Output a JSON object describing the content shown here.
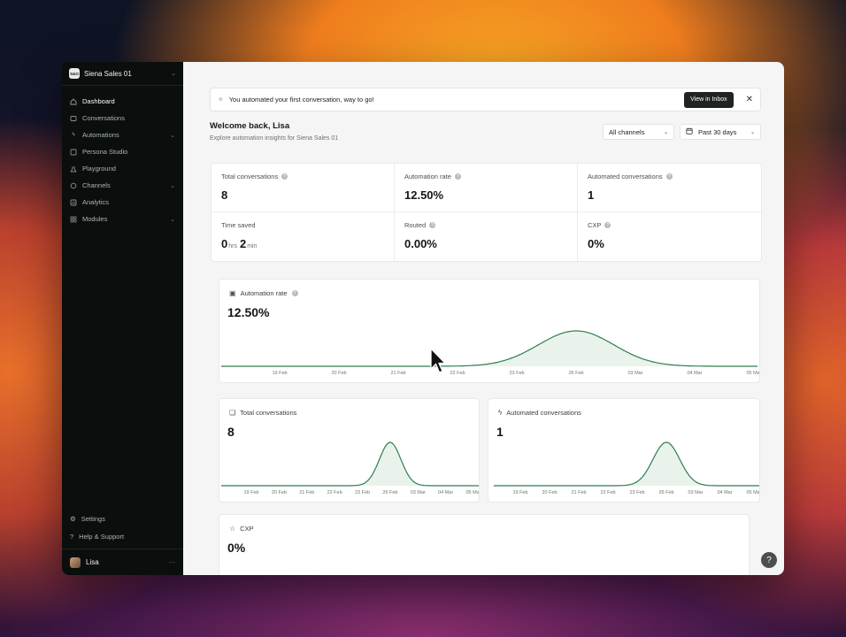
{
  "workspace": {
    "logo_text": "S&O",
    "name": "Siena Sales 01"
  },
  "sidebar": {
    "items": [
      {
        "label": "Dashboard",
        "icon": "home-icon",
        "active": true,
        "has_children": false
      },
      {
        "label": "Conversations",
        "icon": "inbox-icon",
        "active": false,
        "has_children": false
      },
      {
        "label": "Automations",
        "icon": "bolt-icon",
        "active": false,
        "has_children": true
      },
      {
        "label": "Persona Studio",
        "icon": "persona-icon",
        "active": false,
        "has_children": false
      },
      {
        "label": "Playground",
        "icon": "flask-icon",
        "active": false,
        "has_children": false
      },
      {
        "label": "Channels",
        "icon": "chat-icon",
        "active": false,
        "has_children": true
      },
      {
        "label": "Analytics",
        "icon": "chart-icon",
        "active": false,
        "has_children": false
      },
      {
        "label": "Modules",
        "icon": "grid-icon",
        "active": false,
        "has_children": true
      }
    ],
    "settings_label": "Settings",
    "help_label": "Help & Support",
    "user_name": "Lisa"
  },
  "banner": {
    "text": "You automated your first conversation, way to go!",
    "button_label": "View in Inbox"
  },
  "header": {
    "welcome": "Welcome back, Lisa",
    "subtitle": "Explore automation insights for Siena Sales 01",
    "channel_filter": "All channels",
    "date_filter": "Past 30 days"
  },
  "kpis": {
    "total_conversations": {
      "label": "Total conversations",
      "value": "8"
    },
    "automation_rate": {
      "label": "Automation rate",
      "value": "12.50%"
    },
    "automated_conversations": {
      "label": "Automated conversations",
      "value": "1"
    },
    "time_saved": {
      "label": "Time saved",
      "hours": "0",
      "hours_unit": "hrs",
      "minutes": "2",
      "minutes_unit": "min"
    },
    "routed": {
      "label": "Routed",
      "value": "0.00%"
    },
    "cxp": {
      "label": "CXP",
      "value": "0%"
    }
  },
  "colors": {
    "accent": "#2e7d4f",
    "sidebar_bg": "#0a0e0c",
    "fill": "#e9f3ec"
  },
  "chart_data": [
    {
      "type": "area",
      "title": "Automation rate",
      "headline": "12.50%",
      "x": [
        "19 Feb",
        "20 Feb",
        "21 Feb",
        "22 Feb",
        "23 Feb",
        "26 Feb",
        "03 Mar",
        "04 Mar",
        "05 Mar"
      ],
      "peak_index": 5,
      "peak_value": 12.5
    },
    {
      "type": "area",
      "title": "Total conversations",
      "headline": "8",
      "x": [
        "19 Feb",
        "20 Feb",
        "21 Feb",
        "22 Feb",
        "23 Feb",
        "26 Feb",
        "03 Mar",
        "04 Mar",
        "05 Mar"
      ],
      "peak_index": 5,
      "peak_value": 8
    },
    {
      "type": "area",
      "title": "Automated conversations",
      "headline": "1",
      "x": [
        "19 Feb",
        "20 Feb",
        "21 Feb",
        "22 Feb",
        "23 Feb",
        "26 Feb",
        "03 Mar",
        "04 Mar",
        "05 Mar"
      ],
      "peak_index": 5,
      "peak_value": 1
    },
    {
      "type": "area",
      "title": "CXP",
      "headline": "0%"
    }
  ]
}
